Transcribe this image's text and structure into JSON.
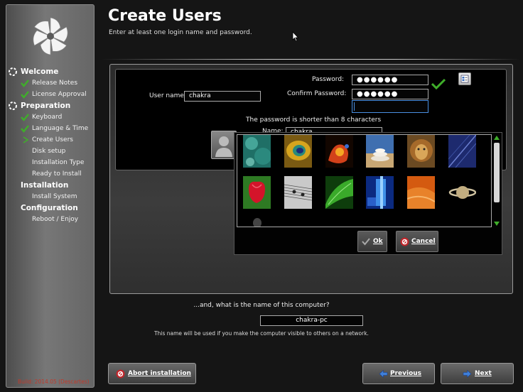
{
  "page": {
    "title": "Create Users",
    "subtitle": "Enter at least one login name and password."
  },
  "sidebar": {
    "sections": [
      {
        "label": "Welcome",
        "items": [
          "Release Notes",
          "License Approval"
        ]
      },
      {
        "label": "Preparation",
        "items": [
          "Keyboard",
          "Language & Time",
          "Create Users",
          "Disk setup",
          "Installation Type",
          "Ready to Install"
        ]
      },
      {
        "label": "Installation",
        "items": [
          "Install System"
        ]
      },
      {
        "label": "Configuration",
        "items": [
          "Reboot / Enjoy"
        ]
      }
    ],
    "build": "Build: 2014.05 (Descartes)"
  },
  "user_form": {
    "username_label": "User name",
    "username_value": "chakra",
    "password_label": "Password:",
    "password_value": "●●●●●●",
    "confirm_label": "Confirm Password:",
    "confirm_value": "●●●●●●",
    "warning": "The password is shorter than 8 characters",
    "name_label": "Name:",
    "name_value": "chakra"
  },
  "avatar_picker": {
    "ok_label": "Ok",
    "cancel_label": "Cancel"
  },
  "hostname": {
    "question": "...and, what is the name of this computer?",
    "value": "chakra-pc",
    "note": "This name will be used if you make the computer visible to others on a network."
  },
  "footer": {
    "abort_label": "Abort installation",
    "previous_label": "Previous",
    "next_label": "Next"
  },
  "colors": {
    "accent_green": "#3fae2a",
    "build_red": "#c0392b"
  }
}
